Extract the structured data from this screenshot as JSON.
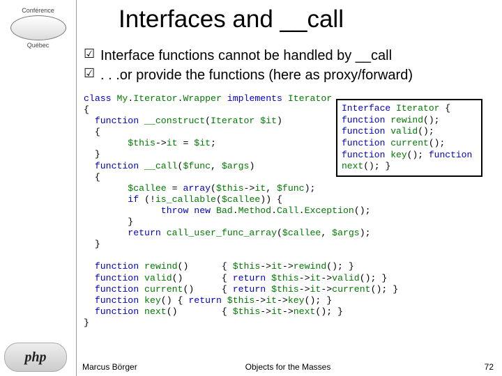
{
  "logo": {
    "top_label": "Conférence",
    "top_sub": "Québec",
    "php_text": "php"
  },
  "title": "Interfaces and __call",
  "bullets": [
    "Interface functions cannot be handled by __call",
    ". . .or provide the functions (here as proxy/forward)"
  ],
  "iface": {
    "l1a": "Interface",
    "l1b": " Iterator ",
    "l1c": "{",
    "l2a": "function",
    "l2b": " rewind",
    "l2c": "();",
    "l3a": "function",
    "l3b": " valid",
    "l3c": "();",
    "l4a": "function",
    "l4b": " current",
    "l4c": "();",
    "l5a": "function",
    "l5b": " key",
    "l5c": "();",
    "l6a": "function",
    "l6b": " next",
    "l6c": "();",
    "l7": "}"
  },
  "code": {
    "r1a": "class",
    "r1b": " My",
    "r1c": ".",
    "r1d": "Iterator",
    "r1e": ".",
    "r1f": "Wrapper ",
    "r1g": "implements",
    "r1h": " Iterator",
    "r2": "{",
    "r3a": "  function",
    "r3b": " __construct",
    "r3c": "(",
    "r3d": "Iterator $it",
    "r3e": ")",
    "r4": "  {",
    "r5a": "        $this",
    "r5b": "->",
    "r5c": "it ",
    "r5d": "= ",
    "r5e": "$it",
    "r5f": ";",
    "r6": "  }",
    "r7a": "  function",
    "r7b": " __call",
    "r7c": "(",
    "r7d": "$func",
    "r7e": ", ",
    "r7f": "$args",
    "r7g": ")",
    "r8": "  {",
    "r9a": "        $callee ",
    "r9b": "= ",
    "r9c": "array",
    "r9d": "(",
    "r9e": "$this",
    "r9f": "->",
    "r9g": "it",
    "r9h": ", ",
    "r9i": "$func",
    "r9j": ");",
    "r10a": "        if ",
    "r10b": "(!",
    "r10c": "is_callable",
    "r10d": "(",
    "r10e": "$callee",
    "r10f": ")) {",
    "r11a": "              throw new ",
    "r11b": "Bad",
    "r11c": ".",
    "r11d": "Method",
    "r11e": ".",
    "r11f": "Call",
    "r11g": ".",
    "r11h": "Exception",
    "r11i": "();",
    "r12": "        }",
    "r13a": "        return ",
    "r13b": "call_user_func_array",
    "r13c": "(",
    "r13d": "$callee",
    "r13e": ", ",
    "r13f": "$args",
    "r13g": ");",
    "r14": "  }",
    "blank": "",
    "r15a": "  function",
    "r15b": " rewind",
    "r15c": "()      { ",
    "r15d": "$this",
    "r15e": "->",
    "r15f": "it",
    "r15g": "->",
    "r15h": "rewind",
    "r15i": "(); }",
    "r16a": "  function",
    "r16b": " valid",
    "r16c": "()       { ",
    "r16d": "return ",
    "r16e": "$this",
    "r16f": "->",
    "r16g": "it",
    "r16h": "->",
    "r16i": "valid",
    "r16j": "(); }",
    "r17a": "  function",
    "r17b": " current",
    "r17c": "()     { ",
    "r17d": "return ",
    "r17e": "$this",
    "r17f": "->",
    "r17g": "it",
    "r17h": "->",
    "r17i": "current",
    "r17j": "(); }",
    "r18a": "  function",
    "r18b": " key",
    "r18c": "() { ",
    "r18d": "return ",
    "r18e": "$this",
    "r18f": "->",
    "r18g": "it",
    "r18h": "->",
    "r18i": "key",
    "r18j": "(); }",
    "r19a": "  function",
    "r19b": " next",
    "r19c": "()        { ",
    "r19d": "$this",
    "r19e": "->",
    "r19f": "it",
    "r19g": "->",
    "r19h": "next",
    "r19i": "(); }",
    "r20": "}"
  },
  "footer": {
    "author": "Marcus Börger",
    "talk": "Objects for the Masses",
    "page": "72"
  }
}
